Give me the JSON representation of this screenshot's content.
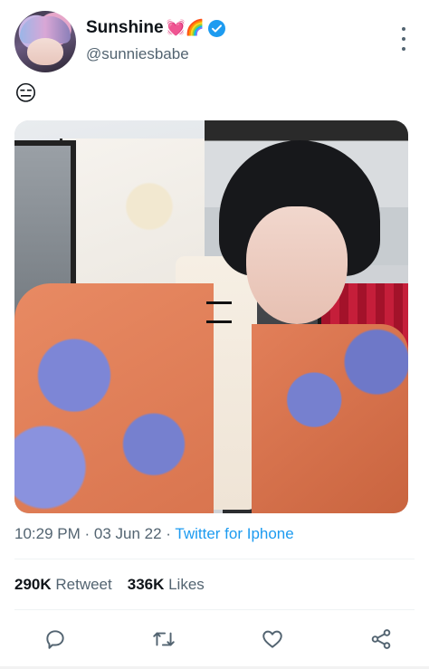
{
  "author": {
    "display_name": "Sunshine",
    "name_emojis": "💓🌈",
    "handle": "@sunniesbabe",
    "verified": true
  },
  "tweet": {
    "text": "😑",
    "media_alt": "Selfie photo"
  },
  "meta": {
    "time": "10:29 PM",
    "separator1": " · ",
    "date": "03 Jun 22",
    "separator2": " · ",
    "source": "Twitter for Iphone"
  },
  "stats": {
    "retweets_count": "290K",
    "retweets_label": " Retweet",
    "likes_count": "336K",
    "likes_label": " Likes"
  },
  "actions": [
    {
      "name": "reply",
      "icon": "speech-bubble-icon"
    },
    {
      "name": "retweet",
      "icon": "retweet-icon"
    },
    {
      "name": "like",
      "icon": "heart-icon"
    },
    {
      "name": "share",
      "icon": "share-icon"
    }
  ],
  "colors": {
    "accent": "#1d9bf0",
    "secondary_text": "#536471",
    "primary_text": "#0f1419"
  }
}
